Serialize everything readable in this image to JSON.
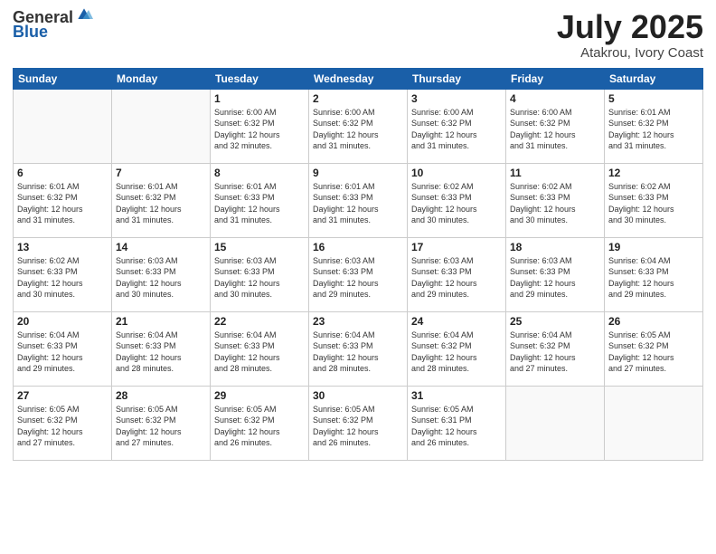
{
  "logo": {
    "general": "General",
    "blue": "Blue"
  },
  "header": {
    "month": "July 2025",
    "location": "Atakrou, Ivory Coast"
  },
  "weekdays": [
    "Sunday",
    "Monday",
    "Tuesday",
    "Wednesday",
    "Thursday",
    "Friday",
    "Saturday"
  ],
  "weeks": [
    [
      {
        "day": "",
        "info": ""
      },
      {
        "day": "",
        "info": ""
      },
      {
        "day": "1",
        "info": "Sunrise: 6:00 AM\nSunset: 6:32 PM\nDaylight: 12 hours\nand 32 minutes."
      },
      {
        "day": "2",
        "info": "Sunrise: 6:00 AM\nSunset: 6:32 PM\nDaylight: 12 hours\nand 31 minutes."
      },
      {
        "day": "3",
        "info": "Sunrise: 6:00 AM\nSunset: 6:32 PM\nDaylight: 12 hours\nand 31 minutes."
      },
      {
        "day": "4",
        "info": "Sunrise: 6:00 AM\nSunset: 6:32 PM\nDaylight: 12 hours\nand 31 minutes."
      },
      {
        "day": "5",
        "info": "Sunrise: 6:01 AM\nSunset: 6:32 PM\nDaylight: 12 hours\nand 31 minutes."
      }
    ],
    [
      {
        "day": "6",
        "info": "Sunrise: 6:01 AM\nSunset: 6:32 PM\nDaylight: 12 hours\nand 31 minutes."
      },
      {
        "day": "7",
        "info": "Sunrise: 6:01 AM\nSunset: 6:32 PM\nDaylight: 12 hours\nand 31 minutes."
      },
      {
        "day": "8",
        "info": "Sunrise: 6:01 AM\nSunset: 6:33 PM\nDaylight: 12 hours\nand 31 minutes."
      },
      {
        "day": "9",
        "info": "Sunrise: 6:01 AM\nSunset: 6:33 PM\nDaylight: 12 hours\nand 31 minutes."
      },
      {
        "day": "10",
        "info": "Sunrise: 6:02 AM\nSunset: 6:33 PM\nDaylight: 12 hours\nand 30 minutes."
      },
      {
        "day": "11",
        "info": "Sunrise: 6:02 AM\nSunset: 6:33 PM\nDaylight: 12 hours\nand 30 minutes."
      },
      {
        "day": "12",
        "info": "Sunrise: 6:02 AM\nSunset: 6:33 PM\nDaylight: 12 hours\nand 30 minutes."
      }
    ],
    [
      {
        "day": "13",
        "info": "Sunrise: 6:02 AM\nSunset: 6:33 PM\nDaylight: 12 hours\nand 30 minutes."
      },
      {
        "day": "14",
        "info": "Sunrise: 6:03 AM\nSunset: 6:33 PM\nDaylight: 12 hours\nand 30 minutes."
      },
      {
        "day": "15",
        "info": "Sunrise: 6:03 AM\nSunset: 6:33 PM\nDaylight: 12 hours\nand 30 minutes."
      },
      {
        "day": "16",
        "info": "Sunrise: 6:03 AM\nSunset: 6:33 PM\nDaylight: 12 hours\nand 29 minutes."
      },
      {
        "day": "17",
        "info": "Sunrise: 6:03 AM\nSunset: 6:33 PM\nDaylight: 12 hours\nand 29 minutes."
      },
      {
        "day": "18",
        "info": "Sunrise: 6:03 AM\nSunset: 6:33 PM\nDaylight: 12 hours\nand 29 minutes."
      },
      {
        "day": "19",
        "info": "Sunrise: 6:04 AM\nSunset: 6:33 PM\nDaylight: 12 hours\nand 29 minutes."
      }
    ],
    [
      {
        "day": "20",
        "info": "Sunrise: 6:04 AM\nSunset: 6:33 PM\nDaylight: 12 hours\nand 29 minutes."
      },
      {
        "day": "21",
        "info": "Sunrise: 6:04 AM\nSunset: 6:33 PM\nDaylight: 12 hours\nand 28 minutes."
      },
      {
        "day": "22",
        "info": "Sunrise: 6:04 AM\nSunset: 6:33 PM\nDaylight: 12 hours\nand 28 minutes."
      },
      {
        "day": "23",
        "info": "Sunrise: 6:04 AM\nSunset: 6:33 PM\nDaylight: 12 hours\nand 28 minutes."
      },
      {
        "day": "24",
        "info": "Sunrise: 6:04 AM\nSunset: 6:32 PM\nDaylight: 12 hours\nand 28 minutes."
      },
      {
        "day": "25",
        "info": "Sunrise: 6:04 AM\nSunset: 6:32 PM\nDaylight: 12 hours\nand 27 minutes."
      },
      {
        "day": "26",
        "info": "Sunrise: 6:05 AM\nSunset: 6:32 PM\nDaylight: 12 hours\nand 27 minutes."
      }
    ],
    [
      {
        "day": "27",
        "info": "Sunrise: 6:05 AM\nSunset: 6:32 PM\nDaylight: 12 hours\nand 27 minutes."
      },
      {
        "day": "28",
        "info": "Sunrise: 6:05 AM\nSunset: 6:32 PM\nDaylight: 12 hours\nand 27 minutes."
      },
      {
        "day": "29",
        "info": "Sunrise: 6:05 AM\nSunset: 6:32 PM\nDaylight: 12 hours\nand 26 minutes."
      },
      {
        "day": "30",
        "info": "Sunrise: 6:05 AM\nSunset: 6:32 PM\nDaylight: 12 hours\nand 26 minutes."
      },
      {
        "day": "31",
        "info": "Sunrise: 6:05 AM\nSunset: 6:31 PM\nDaylight: 12 hours\nand 26 minutes."
      },
      {
        "day": "",
        "info": ""
      },
      {
        "day": "",
        "info": ""
      }
    ]
  ]
}
